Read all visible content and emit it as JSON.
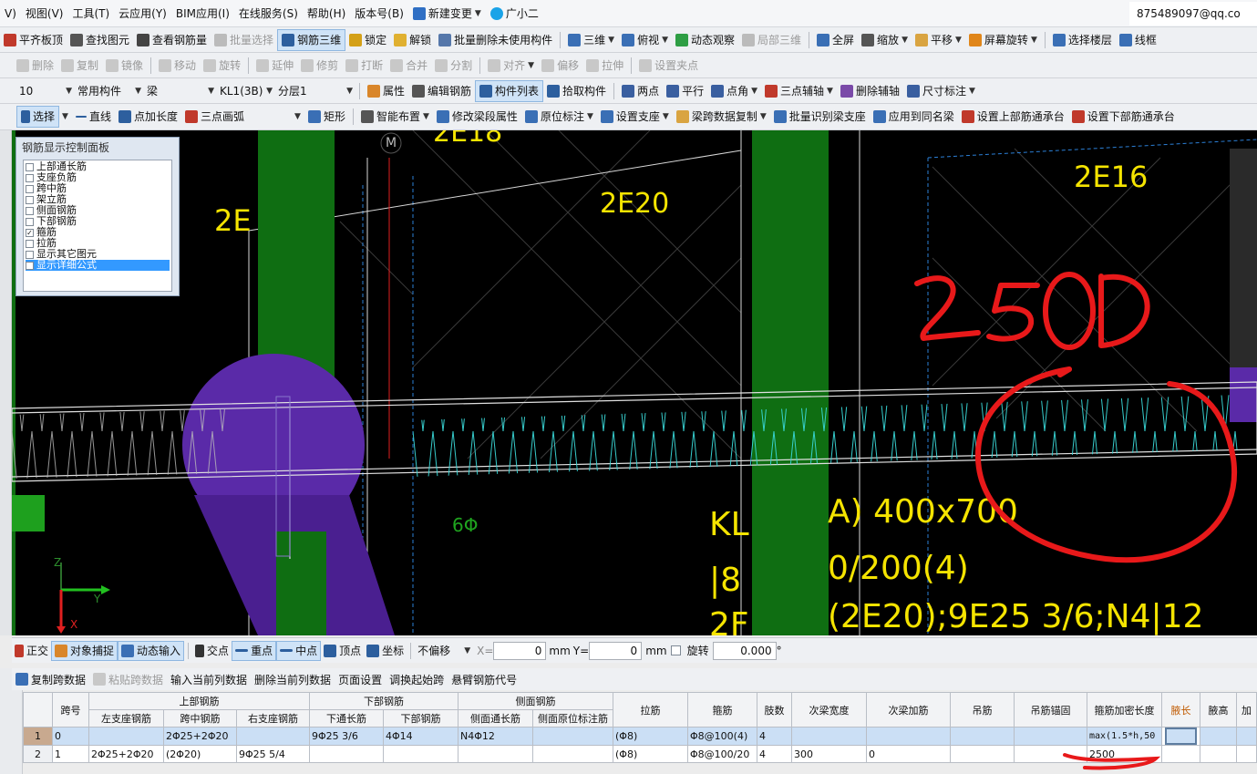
{
  "menu": {
    "items": [
      "V)",
      "视图(V)",
      "工具(T)",
      "云应用(Y)",
      "BIM应用(I)",
      "在线服务(S)",
      "帮助(H)",
      "版本号(B)",
      "新建变更",
      "广小二"
    ],
    "account": "875489097@qq.co"
  },
  "toolbar1": [
    "平齐板顶",
    "查找图元",
    "查看钢筋量",
    "批量选择",
    "钢筋三维",
    "锁定",
    "解锁",
    "批量删除未使用构件",
    "三维",
    "俯视",
    "动态观察",
    "局部三维",
    "全屏",
    "缩放",
    "平移",
    "屏幕旋转",
    "选择楼层",
    "线框"
  ],
  "toolbar2": [
    "删除",
    "复制",
    "镜像",
    "移动",
    "旋转",
    "延伸",
    "修剪",
    "打断",
    "合并",
    "分割",
    "对齐",
    "偏移",
    "拉伸",
    "设置夹点"
  ],
  "toolbar3": {
    "floor": "10",
    "category": "常用构件",
    "type": "梁",
    "component": "KL1(3B)",
    "layer": "分层1",
    "buttons": [
      "属性",
      "编辑钢筋",
      "构件列表",
      "拾取构件",
      "两点",
      "平行",
      "点角",
      "三点辅轴",
      "删除辅轴",
      "尺寸标注"
    ]
  },
  "toolbar4": [
    "选择",
    "直线",
    "点加长度",
    "三点画弧",
    "矩形",
    "智能布置",
    "修改梁段属性",
    "原位标注",
    "设置支座",
    "梁跨数据复制",
    "批量识别梁支座",
    "应用到同名梁",
    "设置上部筋通承台",
    "设置下部筋通承台"
  ],
  "panel": {
    "title": "钢筋显示控制面板",
    "items": [
      {
        "label": "上部通长筋",
        "checked": false
      },
      {
        "label": "支座负筋",
        "checked": false
      },
      {
        "label": "跨中筋",
        "checked": false
      },
      {
        "label": "架立筋",
        "checked": false
      },
      {
        "label": "侧面钢筋",
        "checked": false
      },
      {
        "label": "下部钢筋",
        "checked": false
      },
      {
        "label": "箍筋",
        "checked": true
      },
      {
        "label": "拉筋",
        "checked": false
      },
      {
        "label": "显示其它图元",
        "checked": false
      },
      {
        "label": "显示详细公式",
        "checked": false,
        "highlighted": true
      }
    ]
  },
  "canvas": {
    "labels": {
      "l1": "2E18",
      "l2": "2E20",
      "l3": "2E16",
      "l4": "2E",
      "l5": "KL",
      "l6": "A) 400x700",
      "l7": "|8",
      "l8": "0/200(4)",
      "l9": "2F",
      "l10": "(2E20);9E25 3/6;N4|12",
      "l11": "6Φ",
      "l12": "M"
    },
    "annotation": "2500",
    "axes": {
      "z": "Z",
      "x": "X",
      "y": "Y"
    }
  },
  "status": {
    "buttons": [
      "正交",
      "对象捕捉",
      "动态输入",
      "交点",
      "重点",
      "中点",
      "顶点",
      "坐标"
    ],
    "offset": "不偏移",
    "x_label": "X=",
    "x_value": "0",
    "y_label": "Y=",
    "y_value": "0",
    "unit": "mm",
    "rotate_label": "旋转",
    "rotate_value": "0.000",
    "deg": "°"
  },
  "grid_toolbar": [
    "复制跨数据",
    "粘贴跨数据",
    "输入当前列数据",
    "删除当前列数据",
    "页面设置",
    "调换起始跨",
    "悬臂钢筋代号"
  ],
  "grid": {
    "group_headers": {
      "span": "跨号",
      "top": "上部钢筋",
      "bottom": "下部钢筋",
      "side": "侧面钢筋",
      "tie": "拉筋",
      "stirrup": "箍筋",
      "limbs": "肢数",
      "sb_width": "次梁宽度",
      "sb_add": "次梁加筋",
      "hanger": "吊筋",
      "hanger_anchor": "吊筋锚固",
      "dense": "箍筋加密长度",
      "haunch_len": "腋长",
      "haunch_h": "腋高",
      "more": "加"
    },
    "sub_headers": {
      "top_left": "左支座钢筋",
      "top_mid": "跨中钢筋",
      "top_right": "右支座钢筋",
      "bot_through": "下通长筋",
      "bot_bar": "下部钢筋",
      "side_through": "侧面通长筋",
      "side_orig": "侧面原位标注筋"
    },
    "rows": [
      {
        "no": "1",
        "span": "0",
        "top_left": "",
        "top_mid": "2Φ25+2Φ20",
        "top_right": "",
        "bot_through": "9Φ25 3/6",
        "bot_bar": "4Φ14",
        "side_through": "N4Φ12",
        "side_orig": "",
        "tie": "(Φ8)",
        "stirrup": "Φ8@100(4)",
        "limbs": "4",
        "sb_width": "",
        "sb_add": "",
        "hanger": "",
        "hanger_anchor": "",
        "dense": "max(1.5*h,50",
        "haunch_len": "",
        "haunch_h": ""
      },
      {
        "no": "2",
        "span": "1",
        "top_left": "2Φ25+2Φ20",
        "top_mid": "(2Φ20)",
        "top_right": "9Φ25 5/4",
        "bot_through": "",
        "bot_bar": "",
        "side_through": "",
        "side_orig": "",
        "tie": "(Φ8)",
        "stirrup": "Φ8@100/20",
        "limbs": "4",
        "sb_width": "300",
        "sb_add": "0",
        "hanger": "",
        "hanger_anchor": "",
        "dense": "2500",
        "haunch_len": "",
        "haunch_h": ""
      }
    ]
  },
  "colors": {
    "canvas": "#000000",
    "column": "#0f6e12",
    "stirrup": "#38d6d6",
    "label": "#f5e400",
    "annotation": "#e8191a",
    "purple": "#5a2aa8"
  }
}
